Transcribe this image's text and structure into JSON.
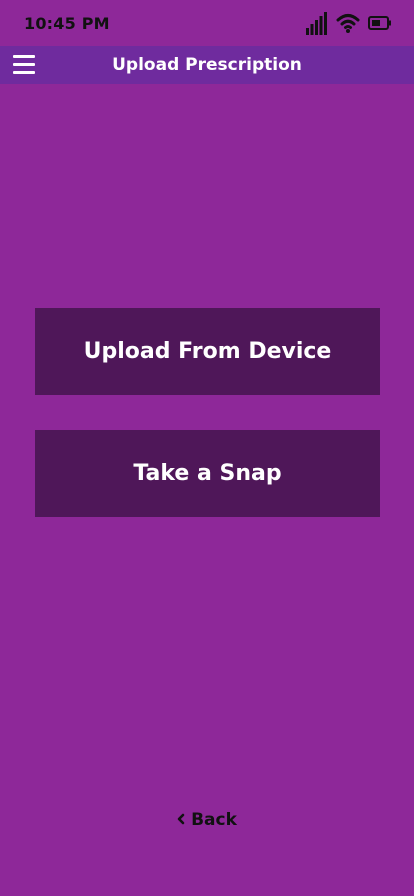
{
  "status_bar": {
    "time": "10:45 PM",
    "icons": [
      "signal-icon",
      "wifi-icon",
      "battery-icon"
    ]
  },
  "header": {
    "menu_icon": "hamburger-menu-icon",
    "title": "Upload Prescription"
  },
  "actions": {
    "upload_label": "Upload From Device",
    "snap_label": "Take a Snap"
  },
  "footer": {
    "back_icon": "chevron-left-icon",
    "back_label": "Back"
  },
  "colors": {
    "background": "#8e2899",
    "header_bar": "#6f2b9e",
    "button_bg": "#4f1759",
    "button_text": "#ffffff",
    "back_text": "#111111"
  }
}
